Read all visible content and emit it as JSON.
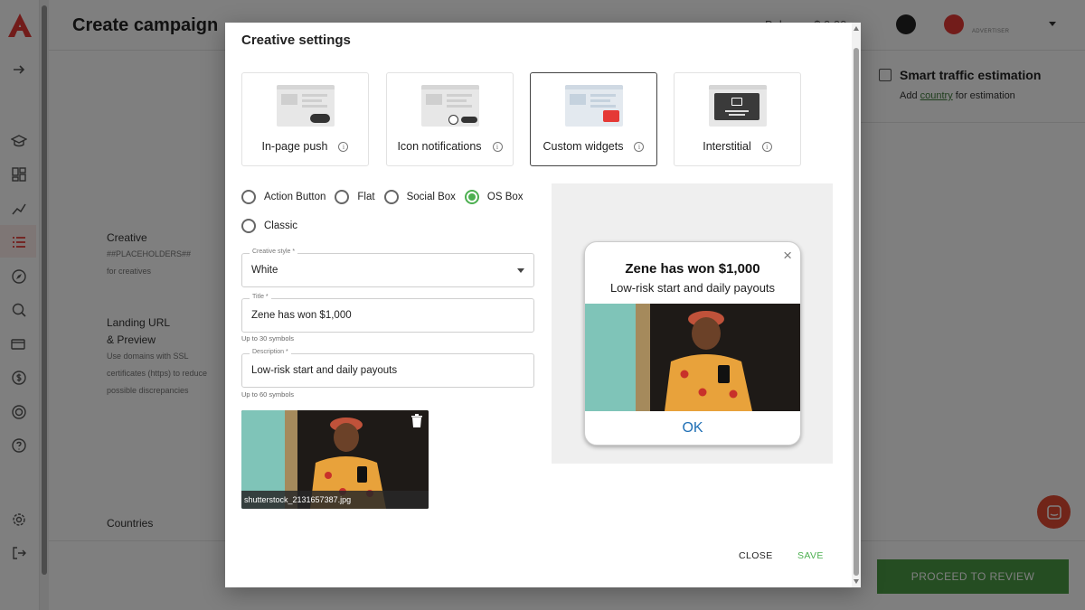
{
  "app": {
    "page_title": "Create campaign",
    "balance": "Balance: $ 0.00",
    "role": "ADVERTISER"
  },
  "colors": {
    "brand": "#e53935",
    "accent_green": "#4caf50",
    "link_blue": "#1f6fb5"
  },
  "sidebar": {
    "icons": [
      "logo-icon",
      "arrow-right-icon",
      "graduation-cap-icon",
      "dashboard-grid-icon",
      "analytics-icon",
      "campaign-list-icon",
      "compass-icon",
      "search-analytics-icon",
      "billing-card-icon",
      "dollar-icon",
      "target-icon",
      "help-icon",
      "settings-icon",
      "logout-icon"
    ]
  },
  "background": {
    "creative_label": "Creative",
    "creative_placeholders": "##PLACEHOLDERS##",
    "creative_sub": "for creatives",
    "landing_label_1": "Landing URL",
    "landing_label_2": "& Preview",
    "landing_sub_1": "Use domains with SSL",
    "landing_sub_2": "certificates (https) to reduce",
    "landing_sub_3": "possible discrepancies",
    "countries_label": "Countries",
    "estimation_title": "Smart traffic estimation",
    "estimation_sub_pre": "Add ",
    "estimation_sub_link": "country",
    "estimation_sub_post": " for estimation",
    "proceed_button": "PROCEED TO REVIEW"
  },
  "modal": {
    "title": "Creative settings",
    "formats": [
      {
        "label": "In-page push",
        "selected": false
      },
      {
        "label": "Icon notifications",
        "selected": false
      },
      {
        "label": "Custom widgets",
        "selected": true
      },
      {
        "label": "Interstitial",
        "selected": false
      }
    ],
    "styles": [
      {
        "label": "Action Button",
        "selected": false
      },
      {
        "label": "Flat",
        "selected": false
      },
      {
        "label": "Social Box",
        "selected": false
      },
      {
        "label": "OS Box",
        "selected": true
      },
      {
        "label": "Classic",
        "selected": false
      }
    ],
    "creative_style": {
      "label": "Creative style *",
      "value": "White"
    },
    "title_field": {
      "label": "Title *",
      "value": "Zene has won $1,000",
      "hint": "Up to 30 symbols"
    },
    "description_field": {
      "label": "Description *",
      "value": "Low-risk start and daily payouts",
      "hint": "Up to 60 symbols"
    },
    "image": {
      "filename": "shutterstock_2131657387.jpg"
    },
    "preview": {
      "title": "Zene has won $1,000",
      "description": "Low-risk start and daily payouts",
      "button": "OK",
      "close": "×"
    },
    "close_button": "CLOSE",
    "save_button": "SAVE"
  }
}
